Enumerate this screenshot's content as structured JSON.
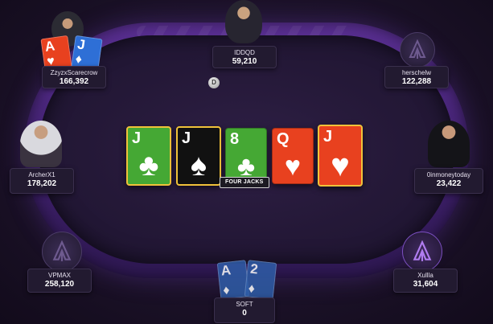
{
  "seats": [
    {
      "id": "top-left",
      "name": "ZzyzxScarecrow",
      "stack": "166,392"
    },
    {
      "id": "top-center",
      "name": "IDDQD",
      "stack": "59,210"
    },
    {
      "id": "top-right",
      "name": "herschelw",
      "stack": "122,288"
    },
    {
      "id": "mid-left",
      "name": "ArcherX1",
      "stack": "178,202"
    },
    {
      "id": "mid-right",
      "name": "0inmoneytoday",
      "stack": "23,422"
    },
    {
      "id": "bottom-left",
      "name": "VPMAX",
      "stack": "258,120"
    },
    {
      "id": "bottom-right",
      "name": "Xullla",
      "stack": "31,604"
    },
    {
      "id": "bottom-center",
      "name": "SOFT",
      "stack": "0"
    }
  ],
  "dealer_button": "D",
  "hole_cards_top_left": [
    {
      "rank": "A",
      "suit": "♥",
      "color": "#e8411f"
    },
    {
      "rank": "J",
      "suit": "♦",
      "color": "#2e6fd6"
    }
  ],
  "hole_cards_hero": [
    {
      "rank": "A",
      "suit": "♦",
      "color": "#2f5da8"
    },
    {
      "rank": "2",
      "suit": "♦",
      "color": "#2f5da8"
    }
  ],
  "board": [
    {
      "rank": "J",
      "suit": "♣",
      "color": "#45a834"
    },
    {
      "rank": "J",
      "suit": "♠",
      "color": "#111111"
    },
    {
      "rank": "8",
      "suit": "♣",
      "color": "#45a834"
    },
    {
      "rank": "Q",
      "suit": "♥",
      "color": "#e8411f"
    },
    {
      "rank": "J",
      "suit": "♥",
      "color": "#e8411f"
    }
  ],
  "hand_label": "FOUR JACKS",
  "colors": {
    "rail": "#4a2680",
    "felt": "#241837",
    "highlight": "#f0c23a"
  }
}
